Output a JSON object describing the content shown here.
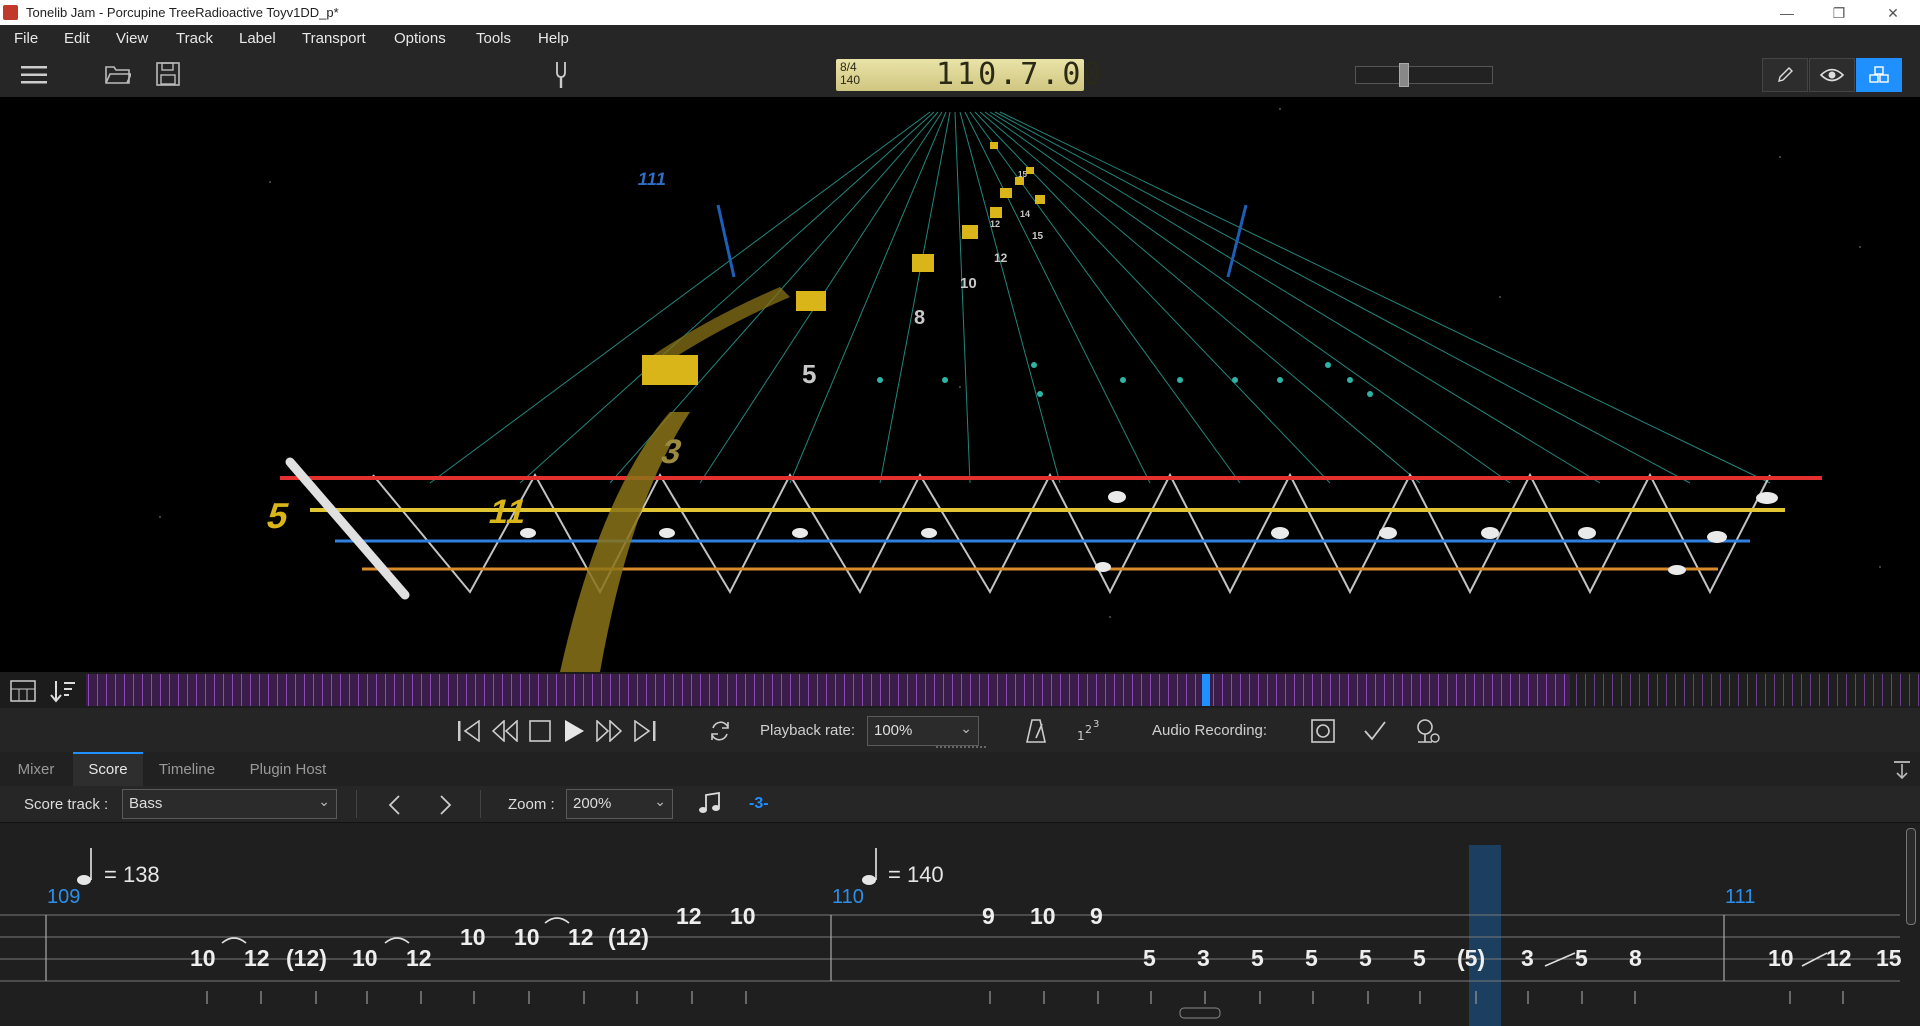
{
  "window": {
    "title": "Tonelib Jam - Porcupine TreeRadioactive Toyv1DD_p*",
    "min": "—",
    "restore": "❐",
    "close": "✕"
  },
  "menu": [
    "File",
    "Edit",
    "View",
    "Track",
    "Label",
    "Transport",
    "Options",
    "Tools",
    "Help"
  ],
  "lcd": {
    "time_sig": "8/4",
    "tempo": "140",
    "position": "110.7.00"
  },
  "viewport": {
    "string_labels": [
      "5",
      "11",
      "3"
    ],
    "measure_number": "111",
    "note_fret_labels": [
      "5",
      "8",
      "10",
      "12",
      "15",
      "14",
      "12",
      "15"
    ]
  },
  "transport": {
    "playback_rate_label": "Playback rate:",
    "playback_rate_value": "100%",
    "audio_recording_label": "Audio Recording:"
  },
  "tabs": [
    "Mixer",
    "Score",
    "Timeline",
    "Plugin Host"
  ],
  "active_tab": "Score",
  "score_toolbar": {
    "score_track_label": "Score track :",
    "score_track_value": "Bass",
    "zoom_label": "Zoom :",
    "zoom_value": "200%",
    "tuplet": "-3-"
  },
  "score": {
    "measures": [
      {
        "number": "109",
        "tempo_text": "= 138"
      },
      {
        "number": "110",
        "tempo_text": "= 140"
      },
      {
        "number": "111",
        "tempo_text": ""
      }
    ],
    "notes": {
      "m109_s3": [
        "10",
        "12",
        "(12)",
        "10",
        "12"
      ],
      "m109_s2": [
        "10",
        "10",
        "12",
        "(12)"
      ],
      "m109_s1": [
        "12",
        "10"
      ],
      "m110_s1": [
        "9",
        "10",
        "9"
      ],
      "m110_s3": [
        "5",
        "3",
        "5",
        "5",
        "5",
        "5",
        "(5)",
        "3",
        "5",
        "8"
      ],
      "m111_s3": [
        "10",
        "12",
        "15"
      ]
    }
  },
  "colors": {
    "accent": "#1e90ff",
    "string_red": "#e53030",
    "string_yellow": "#e2c532",
    "string_blue": "#2f7fe0",
    "string_orange": "#d98a2a",
    "note_block": "#d9b51a",
    "lcd_bg": "#e2dc9c",
    "measure_number": "#2e8fe8"
  },
  "icons": [
    "hamburger-icon",
    "folder-open-icon",
    "save-icon",
    "tuning-fork-icon",
    "pencil-icon",
    "eye-icon",
    "cubes-icon",
    "grid-icon",
    "sort-icon",
    "skip-start-icon",
    "rewind-icon",
    "stop-icon",
    "play-icon",
    "fast-forward-icon",
    "skip-end-icon",
    "loop-icon",
    "metronome-icon",
    "count-in-icon",
    "record-icon",
    "check-icon",
    "record-settings-icon",
    "collapse-icon",
    "prev-icon",
    "next-icon",
    "note-icon"
  ]
}
